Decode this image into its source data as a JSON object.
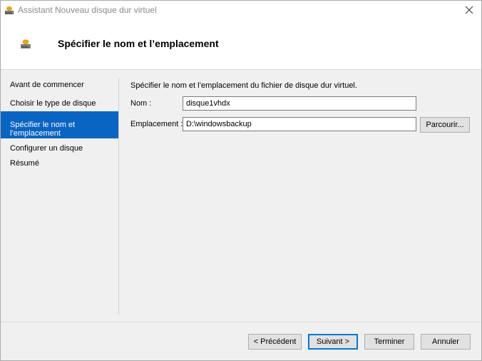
{
  "window": {
    "title": "Assistant Nouveau disque dur virtuel",
    "header_title": "Spécifier le nom et l’emplacement"
  },
  "sidebar": {
    "items": [
      {
        "label": "Avant de commencer",
        "active": false
      },
      {
        "label": "Choisir le type de disque",
        "active": false
      },
      {
        "label": "Spécifier le nom et\nl’emplacement",
        "active": true
      },
      {
        "label": "Configurer un disque",
        "active": false
      },
      {
        "label": "Résumé",
        "active": false
      }
    ]
  },
  "main": {
    "description": "Spécifier le nom et l’emplacement du fichier de disque dur virtuel.",
    "name_label": "Nom :",
    "name_value": "disque1vhdx",
    "location_label": "Emplacement :",
    "location_value": "D:\\windowsbackup",
    "browse_label": "Parcourir..."
  },
  "footer": {
    "previous_label": "< Précédent",
    "next_label": "Suivant >",
    "finish_label": "Terminer",
    "cancel_label": "Annuler"
  },
  "colors": {
    "accent": "#0a64c2",
    "default_button_border": "#0078d7"
  },
  "icons": {
    "title": "disk-icon",
    "header": "disk-icon",
    "close": "close-icon"
  }
}
